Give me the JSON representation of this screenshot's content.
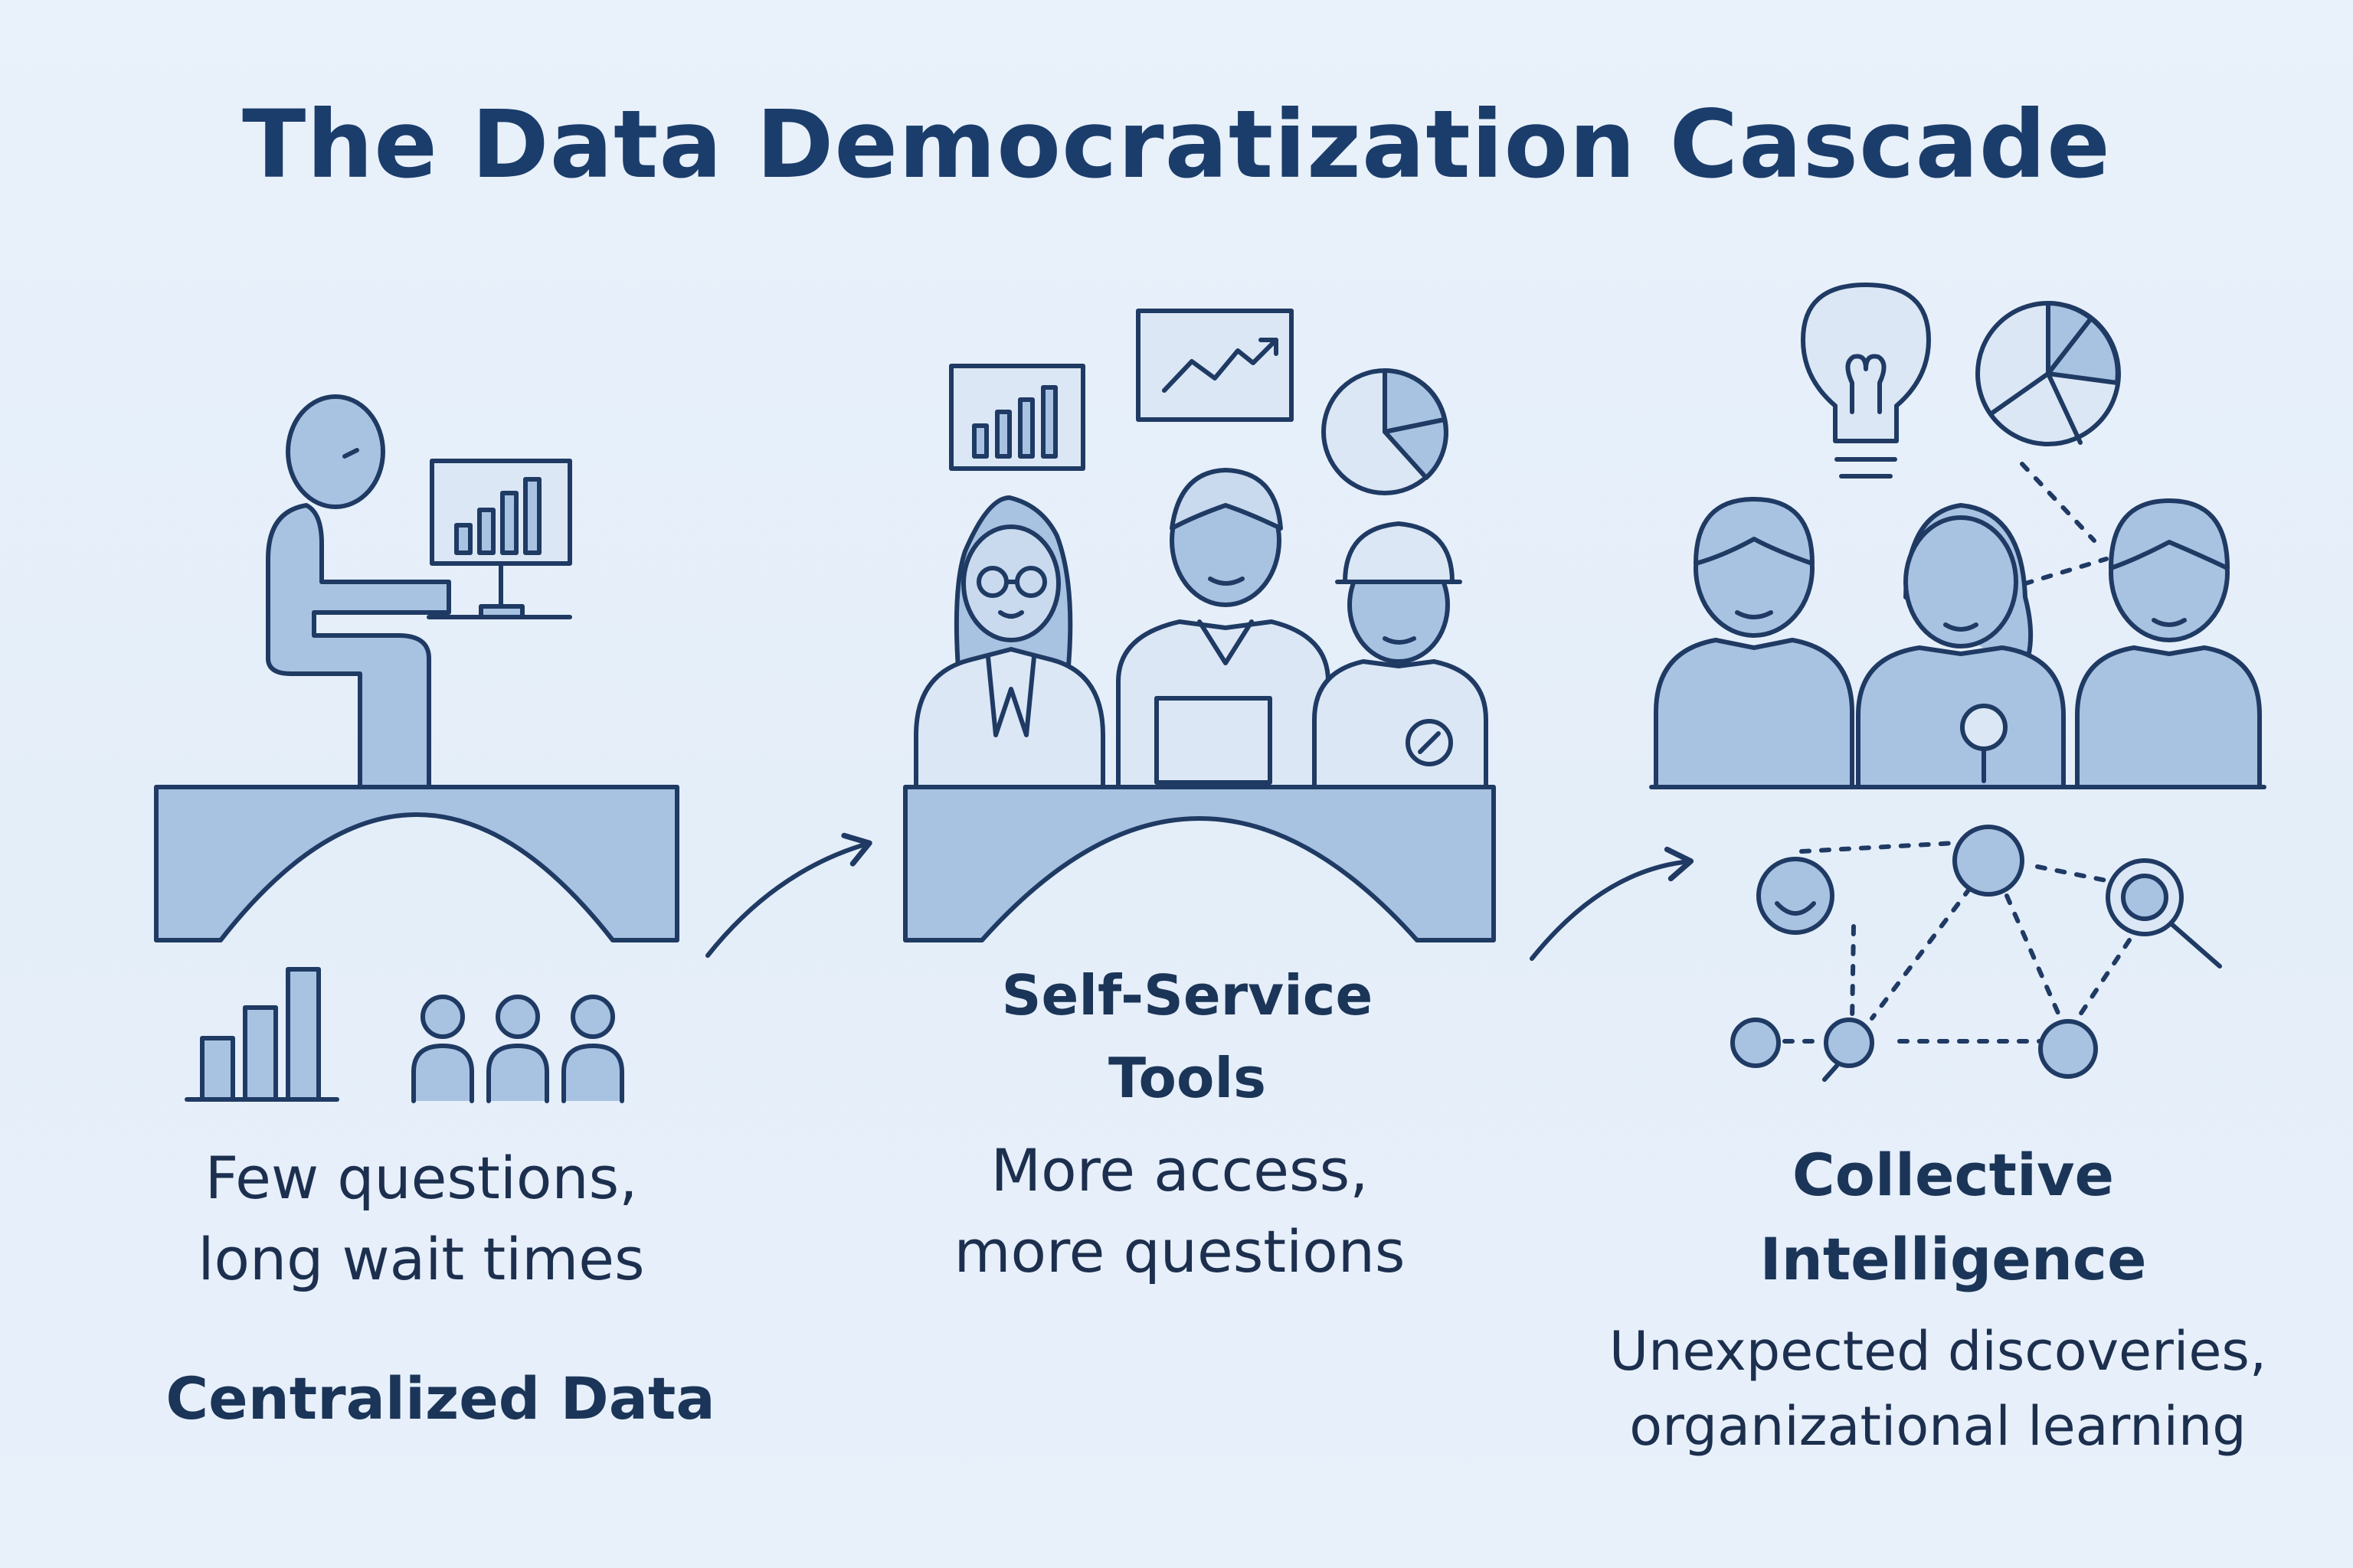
{
  "title": "The Data Democratization Cascade",
  "stages": [
    {
      "heading": "Centralized Data",
      "description": [
        "Few questions,",
        "long wait times"
      ]
    },
    {
      "heading": [
        "Self-Service",
        "Tools"
      ],
      "description": [
        "More access,",
        "more questions"
      ]
    },
    {
      "heading": [
        "Collective",
        "Intelligence"
      ],
      "description": [
        "Unexpected discoveries,",
        "organizational learning"
      ]
    }
  ],
  "colors": {
    "stroke": "#1f3a63",
    "fill": "#a8c3e2",
    "fill_light": "#c9daee",
    "background": "#e6eff9"
  }
}
